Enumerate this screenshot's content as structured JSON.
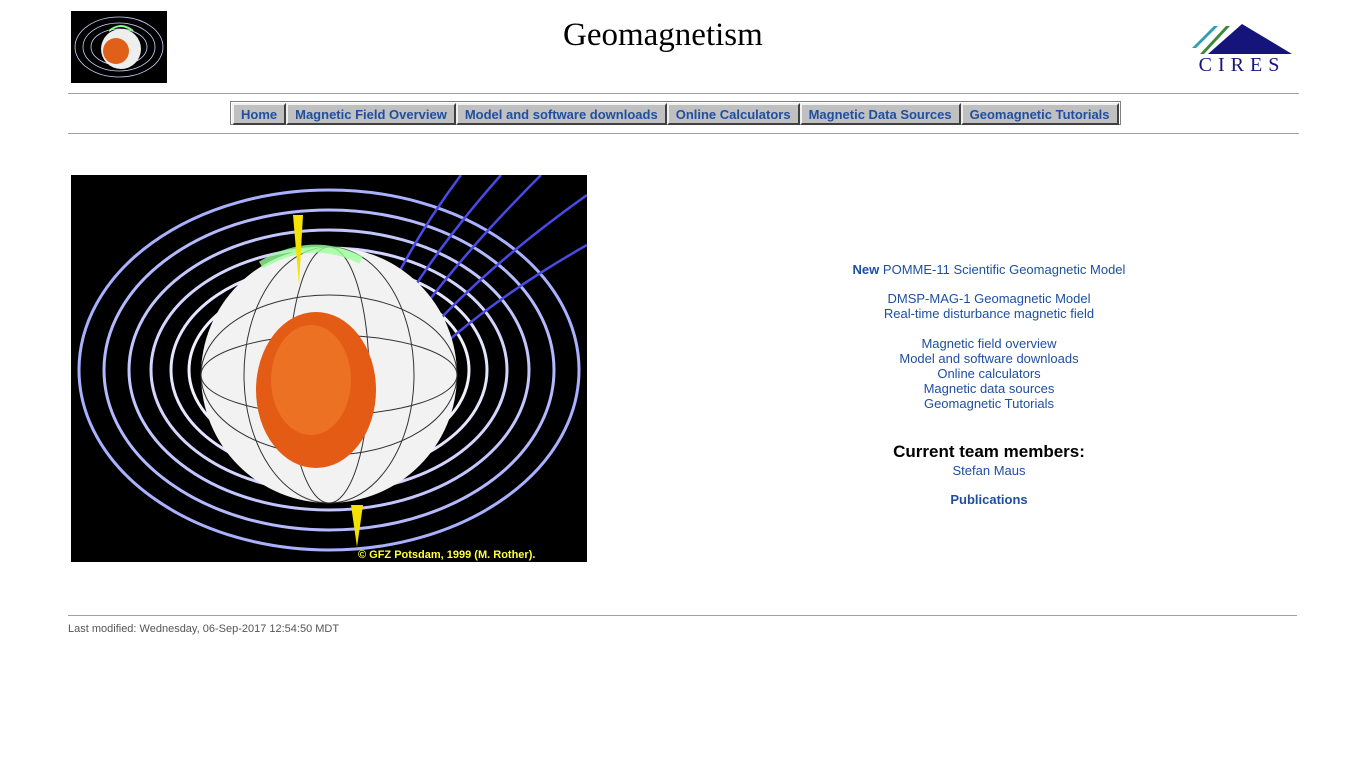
{
  "header": {
    "title": "Geomagnetism",
    "logo_text": "CIRES"
  },
  "nav": {
    "items": [
      {
        "label": "Home"
      },
      {
        "label": "Magnetic Field Overview"
      },
      {
        "label": "Model and software downloads"
      },
      {
        "label": "Online Calculators"
      },
      {
        "label": "Magnetic Data Sources"
      },
      {
        "label": "Geomagnetic Tutorials"
      }
    ]
  },
  "hero": {
    "credit": "© GFZ Potsdam, 1999 (M. Rother)."
  },
  "links": {
    "new_label": "New",
    "pomme": "POMME-11 Scientific Geomagnetic Model",
    "dmsp": "DMSP-MAG-1 Geomagnetic Model",
    "realtime": "Real-time disturbance magnetic field",
    "overview": "Magnetic field overview",
    "downloads": "Model and software downloads",
    "calculators": "Online calculators",
    "sources": "Magnetic data sources",
    "tutorials": "Geomagnetic Tutorials"
  },
  "team": {
    "heading": "Current team members:",
    "member": "Stefan Maus",
    "publications": "Publications"
  },
  "footer": {
    "last_modified": "Last modified: Wednesday, 06-Sep-2017 12:54:50 MDT"
  },
  "colors": {
    "link": "#1f4fa0",
    "nav_button": "#c0c0c0",
    "cires_teal": "#2aa0b8",
    "cires_green": "#3a8a3a",
    "cires_navy": "#14147a"
  }
}
